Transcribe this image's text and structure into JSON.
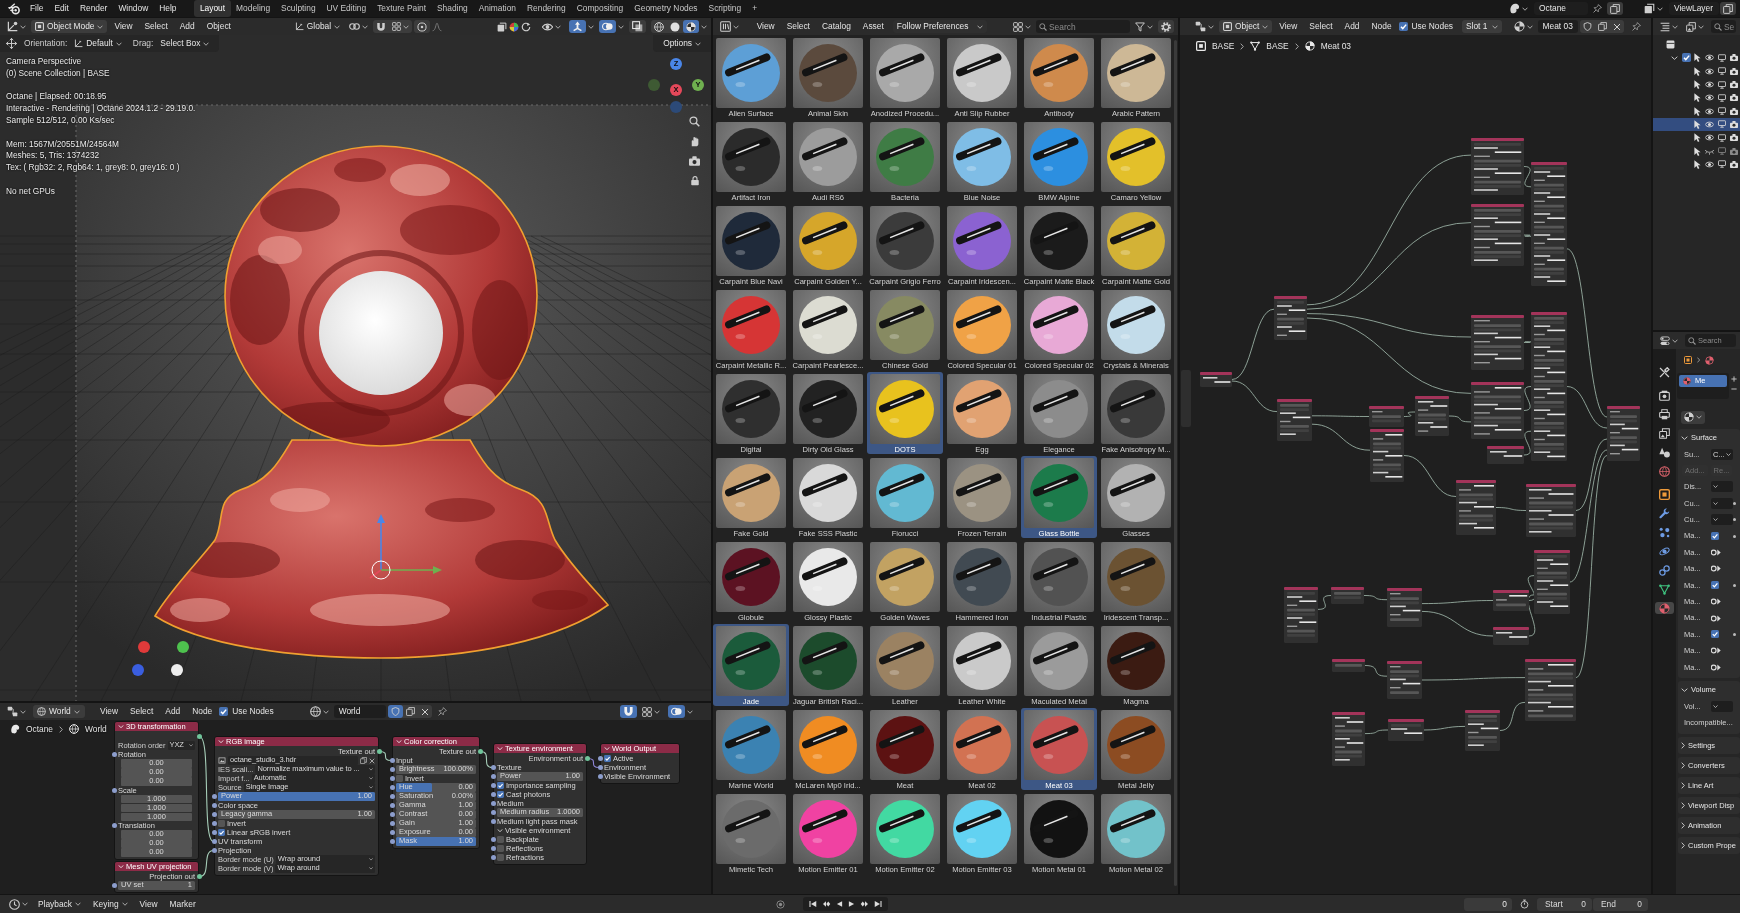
{
  "top_bar": {
    "menus": [
      "File",
      "Edit",
      "Render",
      "Window",
      "Help"
    ],
    "workspaces": [
      {
        "label": "Layout",
        "selected": true
      },
      {
        "label": "Modeling",
        "selected": false
      },
      {
        "label": "Sculpting",
        "selected": false
      },
      {
        "label": "UV Editing",
        "selected": false
      },
      {
        "label": "Texture Paint",
        "selected": false
      },
      {
        "label": "Shading",
        "selected": false
      },
      {
        "label": "Animation",
        "selected": false
      },
      {
        "label": "Rendering",
        "selected": false
      },
      {
        "label": "Compositing",
        "selected": false
      },
      {
        "label": "Geometry Nodes",
        "selected": false
      },
      {
        "label": "Scripting",
        "selected": false
      }
    ],
    "add_workspace": "+",
    "scene": "Octane",
    "view_layer": "ViewLayer"
  },
  "viewport": {
    "header": {
      "mode": "Object Mode",
      "menus": [
        "View",
        "Select",
        "Add",
        "Object"
      ],
      "orientation": "Global",
      "toggles": [
        {
          "kind": "gizmos",
          "on": true
        },
        {
          "kind": "overlays",
          "on": true
        },
        {
          "kind": "xray",
          "on": false
        }
      ],
      "shading": [
        {
          "kind": "wireframe",
          "selected": false
        },
        {
          "kind": "solid",
          "selected": false
        },
        {
          "kind": "rendered",
          "selected": true
        }
      ]
    },
    "tool_settings": {
      "orientation_label": "Orientation:",
      "orientation": "Default",
      "drag_label": "Drag:",
      "drag": "Select Box",
      "options": "Options"
    },
    "overlay": [
      [
        "Camera Perspective",
        "(0) Scene Collection | BASE"
      ],
      [
        "Octane | Elapsed: 00:18.95",
        "Interactive - Rendering | Octane 2024.1.2 - 29.19.0.",
        "Sample 512/512, 0.00 Ks/sec"
      ],
      [
        "Mem: 1567M/20551M/24564M",
        "Meshes: 5, Tris: 1374232",
        "Tex: ( Rgb32: 2, Rgb64: 1, grey8: 0, grey16: 0 )"
      ],
      [
        "No net GPUs"
      ]
    ],
    "gizmo_axes": [
      {
        "kind": "z",
        "label": "Z"
      },
      {
        "kind": "y",
        "label": "Y"
      },
      {
        "kind": "x",
        "label": "X"
      },
      {
        "kind": "neg_y"
      },
      {
        "kind": "neg_z"
      }
    ]
  },
  "world_editor": {
    "data_type": "World",
    "menus": [
      "View",
      "Select",
      "Add",
      "Node"
    ],
    "use_nodes": {
      "label": "Use Nodes",
      "checked": true
    },
    "world": "World",
    "fake_user": true,
    "toggles": [
      {
        "kind": "snap",
        "on": true
      },
      {
        "kind": "overlays",
        "on": true
      }
    ],
    "breadcrumbs": [
      {
        "kind": "scene",
        "label": "Octane"
      },
      {
        "kind": "world",
        "label": "World"
      }
    ],
    "nodes": [
      {
        "title": "3D transformation",
        "rows": [
          {
            "kind": "output"
          },
          {
            "kind": "field",
            "label": "Rotation order",
            "value": "YXZ"
          },
          {
            "kind": "socket",
            "label": "Rotation"
          },
          {
            "kind": "values",
            "values": [
              "0.00",
              "0.00",
              "0.00"
            ]
          },
          {
            "kind": "socket",
            "label": "Scale"
          },
          {
            "kind": "values",
            "values": [
              "1.000",
              "1.000",
              "1.000"
            ]
          },
          {
            "kind": "socket",
            "label": "Translation"
          },
          {
            "kind": "values",
            "values": [
              "0.00",
              "0.00",
              "0.00"
            ]
          }
        ]
      },
      {
        "title": "Mesh UV projection",
        "rows": [
          {
            "kind": "output",
            "label": "Projection out"
          },
          {
            "kind": "number",
            "label": "UV set",
            "value": "1"
          }
        ]
      },
      {
        "title": "RGB image",
        "rows": [
          {
            "kind": "output",
            "label": "Texture out"
          },
          {
            "kind": "file",
            "value": "octane_studio_3.hdr"
          },
          {
            "kind": "field",
            "label": "IES scali...",
            "value": "Normalize maximum value to ..."
          },
          {
            "kind": "field",
            "label": "Import f...",
            "value": "Automatic"
          },
          {
            "kind": "field",
            "label": "Source",
            "value": "Single Image"
          },
          {
            "kind": "slider",
            "label": "Power",
            "value": "1.00",
            "level": 1
          },
          {
            "kind": "socket",
            "label": "Color space"
          },
          {
            "kind": "number",
            "label": "Legacy gamma",
            "value": "1.00"
          },
          {
            "kind": "check",
            "label": "Invert",
            "checked": false
          },
          {
            "kind": "check",
            "label": "Linear sRGB invert",
            "checked": true
          },
          {
            "kind": "socket",
            "label": "UV transform"
          },
          {
            "kind": "socket",
            "label": "Projection"
          },
          {
            "kind": "field",
            "label": "Border mode (U)",
            "value": "Wrap around"
          },
          {
            "kind": "field",
            "label": "Border mode (V)",
            "value": "Wrap around"
          }
        ]
      },
      {
        "title": "Color correction",
        "rows": [
          {
            "kind": "output",
            "label": "Texture out"
          },
          {
            "kind": "socket",
            "label": "Input"
          },
          {
            "kind": "number",
            "label": "Brightness",
            "value": "100.00%"
          },
          {
            "kind": "check",
            "label": "Invert",
            "checked": false
          },
          {
            "kind": "slider",
            "label": "Hue",
            "value": "0.00",
            "level": 0.45
          },
          {
            "kind": "number",
            "label": "Saturation",
            "value": "0.00%"
          },
          {
            "kind": "number",
            "label": "Gamma",
            "value": "1.00"
          },
          {
            "kind": "number",
            "label": "Contrast",
            "value": "0.00"
          },
          {
            "kind": "number",
            "label": "Gain",
            "value": "1.00"
          },
          {
            "kind": "number",
            "label": "Exposure",
            "value": "0.00"
          },
          {
            "kind": "slider",
            "label": "Mask",
            "value": "1.00",
            "level": 1
          }
        ]
      },
      {
        "title": "Texture environment",
        "rows": [
          {
            "kind": "output",
            "label": "Environment out"
          },
          {
            "kind": "socket",
            "label": "Texture"
          },
          {
            "kind": "number",
            "label": "Power",
            "value": "1.00"
          },
          {
            "kind": "check",
            "label": "Importance sampling",
            "checked": true
          },
          {
            "kind": "check",
            "label": "Cast photons",
            "checked": true
          },
          {
            "kind": "socket",
            "label": "Medium"
          },
          {
            "kind": "number",
            "label": "Medium radius",
            "value": "1.0000"
          },
          {
            "kind": "socket",
            "label": "Medium light pass mask"
          },
          {
            "kind": "section",
            "label": "Visible environment",
            "expanded": true
          },
          {
            "kind": "check",
            "label": "Backplate",
            "checked": false
          },
          {
            "kind": "check",
            "label": "Reflections",
            "checked": false
          },
          {
            "kind": "check",
            "label": "Refractions",
            "checked": false
          }
        ]
      },
      {
        "title": "World Output",
        "rows": [
          {
            "kind": "check",
            "label": "Active",
            "checked": true
          },
          {
            "kind": "socket",
            "label": "Environment"
          },
          {
            "kind": "socket",
            "label": "Visible Environment"
          }
        ]
      }
    ]
  },
  "asset_browser": {
    "menus": [
      "View",
      "Select",
      "Catalog",
      "Asset"
    ],
    "import_method": "Follow Preferences",
    "search_placeholder": "Search",
    "assets": [
      {
        "name": "Alien Surface",
        "color": "#5d9fd6",
        "selected": false
      },
      {
        "name": "Animal Skin",
        "color": "#5b4a3d",
        "selected": false
      },
      {
        "name": "Anodized Procedu...",
        "color": "#a9a9a9",
        "selected": false
      },
      {
        "name": "Anti Slip Rubber",
        "color": "#c9c9c9",
        "selected": false
      },
      {
        "name": "Antibody",
        "color": "#cf8a4c",
        "selected": false
      },
      {
        "name": "Arabic Pattern",
        "color": "#cdb896",
        "selected": false
      },
      {
        "name": "Artifact Iron",
        "color": "#2b2b2b",
        "selected": false
      },
      {
        "name": "Audi RS6",
        "color": "#9c9c9c",
        "selected": false
      },
      {
        "name": "Bacteria",
        "color": "#3f7c45",
        "selected": false
      },
      {
        "name": "Blue Noise",
        "color": "#7fbde6",
        "selected": false
      },
      {
        "name": "BMW Alpine",
        "color": "#2c8fe0",
        "selected": false
      },
      {
        "name": "Camaro Yellow",
        "color": "#e3c02a",
        "selected": false
      },
      {
        "name": "Carpaint Blue Navi",
        "color": "#1f2a3a",
        "selected": false
      },
      {
        "name": "Carpaint Golden Y...",
        "color": "#d6a62a",
        "selected": false
      },
      {
        "name": "Carpaint Grigio Ferro",
        "color": "#3b3b3b",
        "selected": false
      },
      {
        "name": "Carpaint Iridescen...",
        "color": "#8b62d1",
        "selected": false
      },
      {
        "name": "Carpaint Matte Black",
        "color": "#1b1b1b",
        "selected": false
      },
      {
        "name": "Carpaint Matte Gold",
        "color": "#d3b236",
        "selected": false
      },
      {
        "name": "Carpaint Metallic R...",
        "color": "#d63535",
        "selected": false
      },
      {
        "name": "Carpaint Pearlesce...",
        "color": "#dcdcd2",
        "selected": false
      },
      {
        "name": "Chinese Gold",
        "color": "#878a62",
        "selected": false
      },
      {
        "name": "Colored Specular 01",
        "color": "#f0a246",
        "selected": false
      },
      {
        "name": "Colored Specular 02",
        "color": "#e8a9d6",
        "selected": false
      },
      {
        "name": "Crystals & Minerals",
        "color": "#c3dcea",
        "selected": false
      },
      {
        "name": "Digital",
        "color": "#2f2f2f",
        "selected": false
      },
      {
        "name": "Dirty Old Glass",
        "color": "#222222",
        "selected": false
      },
      {
        "name": "DOTS",
        "color": "#e8c21e",
        "selected": true
      },
      {
        "name": "Egg",
        "color": "#e1a272",
        "selected": false
      },
      {
        "name": "Elegance",
        "color": "#8c8c8c",
        "selected": false
      },
      {
        "name": "Fake Anisotropy M...",
        "color": "#393939",
        "selected": false
      },
      {
        "name": "Fake Gold",
        "color": "#c9a274",
        "selected": false
      },
      {
        "name": "Fake SSS Plastic",
        "color": "#d9d9d9",
        "selected": false
      },
      {
        "name": "Fiorucci",
        "color": "#62b9d2",
        "selected": false
      },
      {
        "name": "Frozen Terrain",
        "color": "#9b9282",
        "selected": false
      },
      {
        "name": "Glass Bottle",
        "color": "#1c7b4b",
        "selected": true
      },
      {
        "name": "Glasses",
        "color": "#b2b2b2",
        "selected": false
      },
      {
        "name": "Globule",
        "color": "#5c1222",
        "selected": false
      },
      {
        "name": "Glossy Plastic",
        "color": "#e9e9e9",
        "selected": false
      },
      {
        "name": "Golden Waves",
        "color": "#c2a262",
        "selected": false
      },
      {
        "name": "Hammered Iron",
        "color": "#414a52",
        "selected": false
      },
      {
        "name": "Industrial Plastic",
        "color": "#525252",
        "selected": false
      },
      {
        "name": "Iridescent Transp...",
        "color": "#6b5232",
        "selected": false
      },
      {
        "name": "Jade",
        "color": "#1b5b3b",
        "selected": true
      },
      {
        "name": "Jaguar British Raci...",
        "color": "#1c4b2c",
        "selected": false
      },
      {
        "name": "Leather",
        "color": "#9b8262",
        "selected": false
      },
      {
        "name": "Leather White",
        "color": "#cacaca",
        "selected": false
      },
      {
        "name": "Maculated Metal",
        "color": "#9b9b9b",
        "selected": false
      },
      {
        "name": "Magma",
        "color": "#3b1b12",
        "selected": false
      },
      {
        "name": "Marine World",
        "color": "#3b82b2",
        "selected": false
      },
      {
        "name": "McLaren Mp0 Irid...",
        "color": "#f08c22",
        "selected": false
      },
      {
        "name": "Meat",
        "color": "#5c1212",
        "selected": false
      },
      {
        "name": "Meat 02",
        "color": "#d27252",
        "selected": false
      },
      {
        "name": "Meat 03",
        "color": "#c85252",
        "selected": true
      },
      {
        "name": "Metal Jelly",
        "color": "#8c4c22",
        "selected": false
      },
      {
        "name": "Mimetic Tech",
        "color": "#6b6b6b",
        "selected": false
      },
      {
        "name": "Motion Emitter 01",
        "color": "#f042a2",
        "selected": false
      },
      {
        "name": "Motion Emitter 02",
        "color": "#42d9a2",
        "selected": false
      },
      {
        "name": "Motion Emitter 03",
        "color": "#62d2f2",
        "selected": false
      },
      {
        "name": "Motion Metal 01",
        "color": "#121212",
        "selected": false
      },
      {
        "name": "Motion Metal 02",
        "color": "#72c2ca",
        "selected": false
      }
    ]
  },
  "shader_editor": {
    "object_type": "Object",
    "menus": [
      "View",
      "Select",
      "Add",
      "Node"
    ],
    "use_nodes": {
      "label": "Use Nodes",
      "checked": true
    },
    "slot": "Slot 1",
    "material": "Meat 03",
    "fake_user": false,
    "breadcrumbs": [
      {
        "kind": "object",
        "label": "BASE"
      },
      {
        "kind": "mesh",
        "label": "BASE"
      },
      {
        "kind": "material",
        "label": "Meat 03"
      }
    ]
  },
  "outliner": {
    "search_placeholder": "Se",
    "collection": {
      "checked": true,
      "expanded": true,
      "children": [
        {
          "selected": false,
          "hidden": false
        },
        {
          "selected": false,
          "hidden": false
        },
        {
          "selected": false,
          "hidden": false
        },
        {
          "selected": false,
          "hidden": false
        },
        {
          "selected": true,
          "hidden": false
        },
        {
          "selected": false,
          "hidden": false
        },
        {
          "selected": false,
          "hidden": true
        },
        {
          "selected": false,
          "hidden": false
        }
      ]
    }
  },
  "properties": {
    "search_placeholder": "Search",
    "tabs": [
      {
        "kind": "tool",
        "selected": false
      },
      {
        "kind": "render",
        "selected": false
      },
      {
        "kind": "output",
        "selected": false
      },
      {
        "kind": "view_layer",
        "selected": false
      },
      {
        "kind": "scene",
        "selected": false
      },
      {
        "kind": "world",
        "selected": false
      },
      {
        "kind": "object",
        "selected": false
      },
      {
        "kind": "modifiers",
        "selected": false
      },
      {
        "kind": "particles",
        "selected": false
      },
      {
        "kind": "physics",
        "selected": false
      },
      {
        "kind": "constraints",
        "selected": false
      },
      {
        "kind": "data",
        "selected": false
      },
      {
        "kind": "material",
        "selected": true
      }
    ],
    "material_slot": {
      "label": "Me",
      "selected": true
    },
    "panels": [
      {
        "title": "Surface",
        "expanded": true,
        "rows": [
          {
            "kind": "dropdown",
            "label": "Su...",
            "value": "C...",
            "decorator": false
          },
          {
            "kind": "buttons",
            "buttons": [
              {
                "label": "Add...",
                "disabled": true
              },
              {
                "label": "Re...",
                "disabled": true
              }
            ]
          },
          {
            "kind": "dropdown",
            "label": "Dis...",
            "decorator": false
          },
          {
            "kind": "dropdown",
            "label": "Cu...",
            "decorator": true
          },
          {
            "kind": "dropdown",
            "label": "Cu...",
            "decorator": true
          },
          {
            "kind": "check",
            "label": "Ma...",
            "checked": true,
            "decorator": true
          },
          {
            "kind": "link",
            "label": "Ma..."
          },
          {
            "kind": "link",
            "label": "Ma..."
          },
          {
            "kind": "check",
            "label": "Ma...",
            "checked": true,
            "decorator": true
          },
          {
            "kind": "link",
            "label": "Ma..."
          },
          {
            "kind": "link",
            "label": "Ma..."
          },
          {
            "kind": "check",
            "label": "Ma...",
            "checked": true,
            "decorator": true
          },
          {
            "kind": "link",
            "label": "Ma..."
          },
          {
            "kind": "link",
            "label": "Ma..."
          }
        ]
      },
      {
        "title": "Volume",
        "expanded": true,
        "rows": [
          {
            "kind": "dropdown",
            "label": "Vol...",
            "decorator": false
          },
          {
            "kind": "note",
            "label": "Incompatible..."
          }
        ]
      },
      {
        "title": "Settings",
        "expanded": false
      },
      {
        "title": "Converters",
        "expanded": false
      },
      {
        "title": "Line Art",
        "expanded": false
      },
      {
        "title": "Viewport Disp",
        "expanded": false
      },
      {
        "title": "Animation",
        "expanded": false
      },
      {
        "title": "Custom Prope",
        "expanded": false
      }
    ]
  },
  "timeline": {
    "menus": [
      {
        "label": "Playback",
        "dropdown": true
      },
      {
        "label": "Keying",
        "dropdown": true
      },
      {
        "label": "View",
        "dropdown": false
      },
      {
        "label": "Marker",
        "dropdown": false
      }
    ],
    "current_frame": "0",
    "start_label": "Start",
    "start": "0",
    "end_label": "End",
    "end": "0"
  }
}
